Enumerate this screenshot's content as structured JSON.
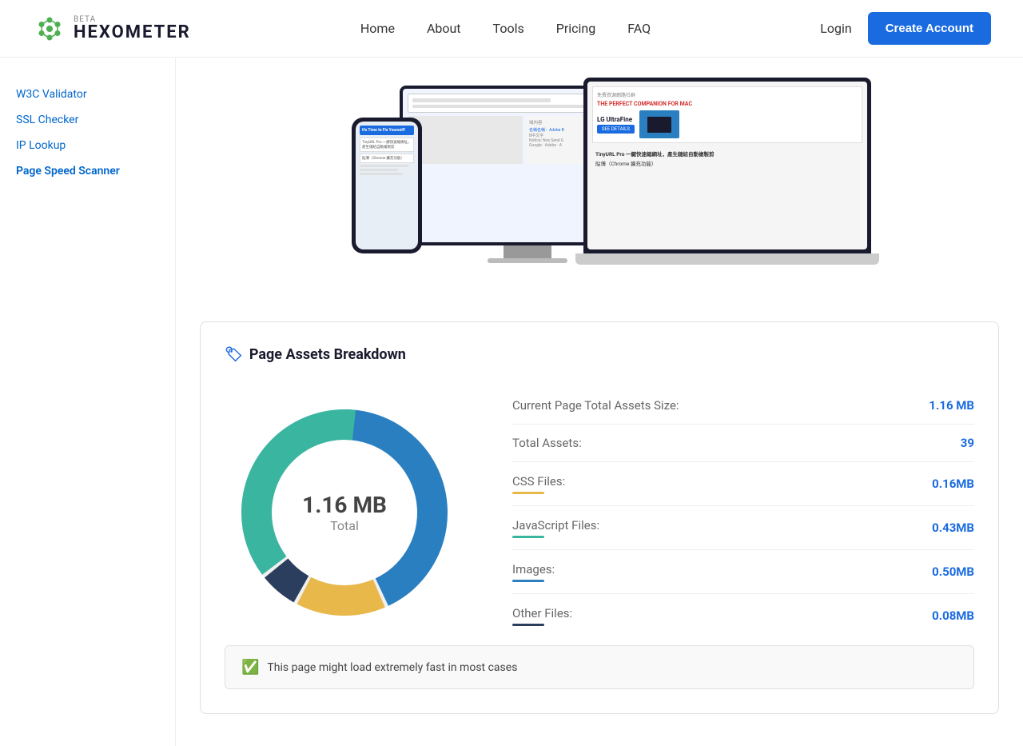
{
  "header": {
    "logo_beta": "BETA",
    "logo_name": "HEXOMETER",
    "nav": [
      {
        "label": "Home",
        "id": "home"
      },
      {
        "label": "About",
        "id": "about"
      },
      {
        "label": "Tools",
        "id": "tools"
      },
      {
        "label": "Pricing",
        "id": "pricing"
      },
      {
        "label": "FAQ",
        "id": "faq"
      }
    ],
    "login_label": "Login",
    "create_account_label": "Create Account"
  },
  "sidebar": {
    "items": [
      {
        "label": "W3C Validator",
        "id": "w3c"
      },
      {
        "label": "SSL Checker",
        "id": "ssl"
      },
      {
        "label": "IP Lookup",
        "id": "ip"
      },
      {
        "label": "Page Speed Scanner",
        "id": "pagespeed",
        "active": true
      }
    ]
  },
  "breakdown": {
    "title": "Page Assets Breakdown",
    "donut": {
      "value": "1.16 MB",
      "label": "Total",
      "segments": [
        {
          "label": "JavaScript",
          "color": "#3ab5a0",
          "pct": 37
        },
        {
          "label": "Images",
          "color": "#2a7fc1",
          "pct": 43
        },
        {
          "label": "CSS",
          "color": "#e8b84b",
          "pct": 14
        },
        {
          "label": "Other",
          "color": "#2c3e5e",
          "pct": 6
        }
      ]
    },
    "stats": [
      {
        "label": "Current Page Total Assets Size:",
        "value": "1.16 MB",
        "color": "#1a6be0"
      },
      {
        "label": "Total Assets:",
        "value": "39",
        "color": "#1a6be0"
      },
      {
        "label": "CSS Files:",
        "value": "0.16MB",
        "underline_color": "#e8b84b"
      },
      {
        "label": "JavaScript Files:",
        "value": "0.43MB",
        "underline_color": "#3ab5a0"
      },
      {
        "label": "Images:",
        "value": "0.50MB",
        "underline_color": "#2a7fc1"
      },
      {
        "label": "Other Files:",
        "value": "0.08MB",
        "underline_color": "#2c3e5e"
      }
    ]
  },
  "status": {
    "icon": "✓",
    "text": "This page might load extremely fast in most cases"
  }
}
